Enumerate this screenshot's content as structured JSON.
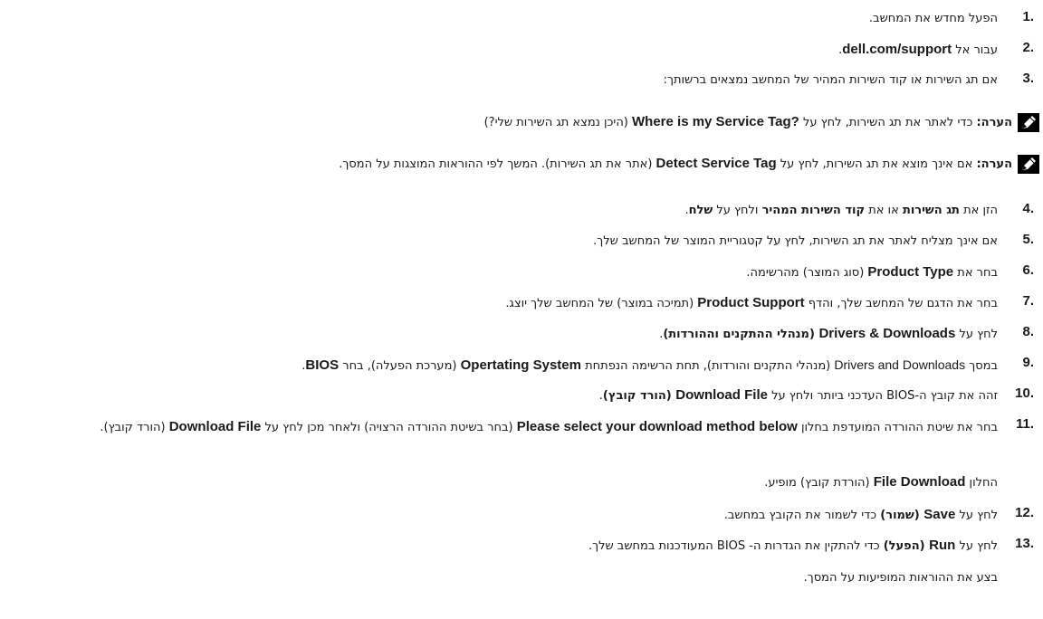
{
  "steps": {
    "s1": {
      "num": "1.",
      "text": "הפעל מחדש את המחשב."
    },
    "s2": {
      "num": "2.",
      "pre": "עבור אל ",
      "link": "dell.com/support",
      "post": "."
    },
    "s3": {
      "num": "3.",
      "text": "אם תג השירות או קוד השירות המהיר של המחשב נמצאים ברשותך:"
    },
    "note1": {
      "label": "הערה:",
      "pre": " כדי לאתר את תג השירות, לחץ על ",
      "en": "Where is my Service Tag?",
      "post": " (היכן נמצא תג השירות שלי?)"
    },
    "note2": {
      "label": "הערה:",
      "pre": " אם אינך מוצא את תג השירות, לחץ על ",
      "en": "Detect Service Tag",
      "post": " (אתר את תג השירות). המשך לפי ההוראות המוצגות על המסך."
    },
    "s4": {
      "num": "4.",
      "pre": "הזן את ",
      "b1": "תג השירות",
      "mid1": " או את ",
      "b2": "קוד השירות המהיר",
      "mid2": " ולחץ על ",
      "b3": "שלח",
      "post": "."
    },
    "s5": {
      "num": "5.",
      "text": "אם אינך מצליח לאתר את תג השירות, לחץ על קטגוריית המוצר של המחשב שלך."
    },
    "s6": {
      "num": "6.",
      "pre": "בחר את ",
      "en": "Product Type",
      "post": " (סוג המוצר) מהרשימה."
    },
    "s7": {
      "num": "7.",
      "pre": "בחר את הדגם של המחשב שלך, והדף ",
      "en": "Product Support",
      "post": " (תמיכה במוצר) של המחשב שלך יוצג."
    },
    "s8": {
      "num": "8.",
      "pre": "לחץ על ",
      "en": "Drivers & Downloads",
      "post_b": " (מנהלי ההתקנים וההורדות)",
      "post": "."
    },
    "s9": {
      "num": "9.",
      "pre": "במסך ",
      "en_plain": "Drivers and Downloads",
      "mid": " (מנהלי התקנים והורדות), תחת הרשימה הנפתחת ",
      "en": "Opertating System",
      "mid2": " (מערכת הפעלה), בחר ",
      "en2": "BIOS",
      "post": "."
    },
    "s10": {
      "num": "10.",
      "pre": "זהה את קובץ ה-BIOS העדכני ביותר ולחץ על ",
      "en": "Download File",
      "post_b": " (הורד קובץ)",
      "post": "."
    },
    "s11": {
      "num": "11.",
      "pre": "בחר את שיטת ההורדה המועדפת בחלון ",
      "en": "Please select your download method below",
      "mid": " (בחר בשיטת ההורדה הרצויה) ולאחר מכן לחץ על ",
      "en2": "Download File",
      "post": " (הורד קובץ)."
    },
    "s11b": {
      "pre": "החלון ",
      "en": "File Download",
      "post": " (הורדת קובץ) מופיע."
    },
    "s12": {
      "num": "12.",
      "pre": "לחץ על ",
      "en": "Save",
      "post_b": " (שמור)",
      "post": " כדי לשמור את הקובץ במחשב."
    },
    "s13": {
      "num": "13.",
      "pre": "לחץ על ",
      "en": "Run",
      "post_b": " (הפעל)",
      "post": " כדי להתקין את הגדרות ה- BIOS המעודכנות במחשב שלך."
    },
    "s13b": {
      "text": "בצע את ההוראות המופיעות על המסך."
    }
  }
}
